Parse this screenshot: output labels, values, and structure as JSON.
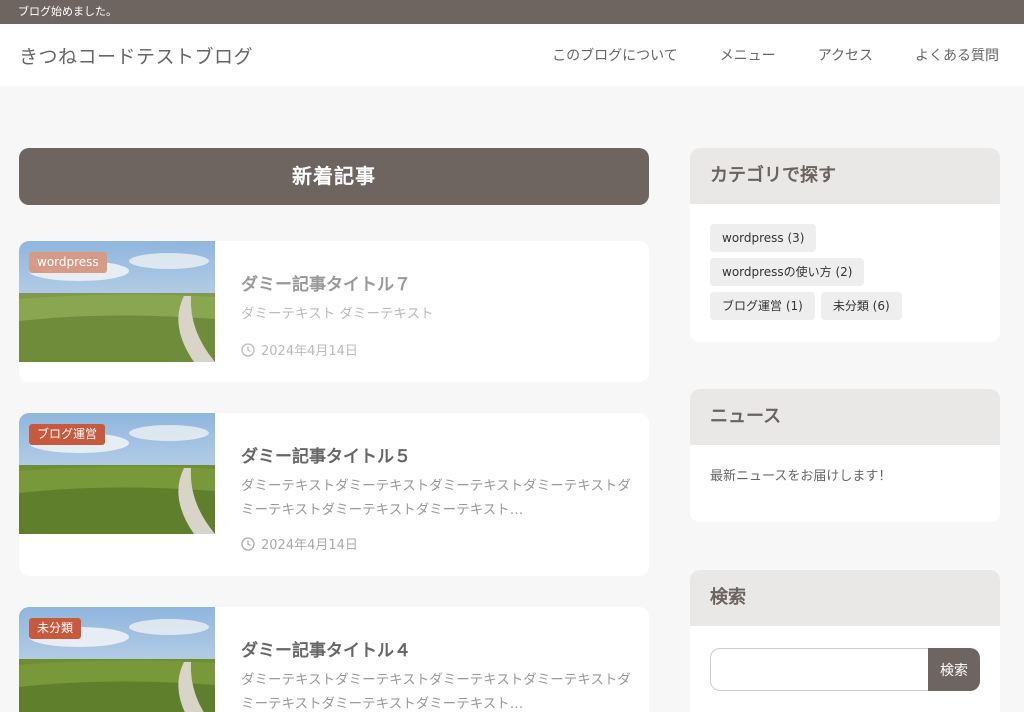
{
  "topbar": {
    "text": "ブログ始めました。"
  },
  "header": {
    "site_title": "きつねコードテストブログ",
    "nav": [
      "このブログについて",
      "メニュー",
      "アクセス",
      "よくある質問"
    ]
  },
  "main": {
    "section_title": "新着記事",
    "posts": [
      {
        "category": "wordpress",
        "category_color": "#d69a86",
        "title": "ダミー記事タイトル７",
        "excerpt": "ダミーテキスト ダミーテキスト",
        "date": "2024年4月14日"
      },
      {
        "category": "ブログ運営",
        "category_color": "#c75a3d",
        "title": "ダミー記事タイトル５",
        "excerpt": "ダミーテキストダミーテキストダミーテキストダミーテキストダミーテキストダミーテキストダミーテキスト…",
        "date": "2024年4月14日"
      },
      {
        "category": "未分類",
        "category_color": "#c75a3d",
        "title": "ダミー記事タイトル４",
        "excerpt": "ダミーテキストダミーテキストダミーテキストダミーテキストダミーテキストダミーテキストダミーテキスト…"
      }
    ]
  },
  "sidebar": {
    "categories": {
      "title": "カテゴリで探す",
      "items": [
        "wordpress (3)",
        "wordpressの使い方 (2)",
        "ブログ運営 (1)",
        "未分類 (6)"
      ]
    },
    "news": {
      "title": "ニュース",
      "text": "最新ニュースをお届けします！"
    },
    "search": {
      "title": "検索",
      "placeholder": "",
      "button_label": "検索"
    }
  },
  "colors": {
    "brand": "#6f6560",
    "widget_head": "#eae8e6",
    "background": "#f7f7f7"
  }
}
